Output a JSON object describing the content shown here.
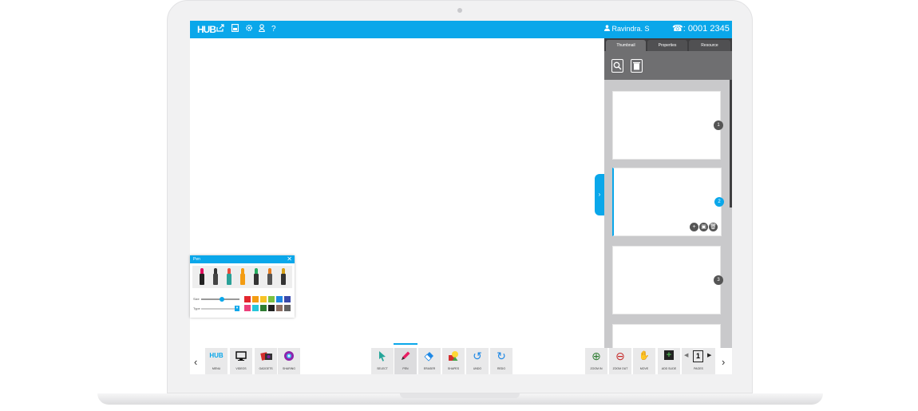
{
  "header": {
    "logo": "HUB",
    "icons": [
      "share-icon",
      "save-icon",
      "settings-icon",
      "user-icon",
      "help-icon"
    ],
    "help_glyph": "?",
    "user_name": "Ravindra. S",
    "phone_glyph": "☎",
    "phone_text": ": 0001 2345"
  },
  "right_panel": {
    "tabs": [
      {
        "label": "Thumbnail",
        "active": true
      },
      {
        "label": "Properties",
        "active": false
      },
      {
        "label": "Resource",
        "active": false
      }
    ],
    "tools": [
      "search-icon",
      "trash-icon"
    ],
    "thumbnails": [
      {
        "number": "1",
        "active": false
      },
      {
        "number": "2",
        "active": true
      },
      {
        "number": "3",
        "active": false
      },
      {
        "number": "",
        "active": false
      }
    ],
    "thumb_actions": [
      "+",
      "▣",
      "🗑"
    ]
  },
  "collapse_glyph": "›",
  "pen_dialog": {
    "title": "Pen",
    "close": "✕",
    "size_label": "Size",
    "type_label": "Type",
    "size_value": 0.55,
    "pens": [
      {
        "tip": "#e0115f",
        "body": "#222222"
      },
      {
        "tip": "#333333",
        "body": "#444444"
      },
      {
        "tip": "#e74c3c",
        "body": "#2aa198"
      },
      {
        "tip": "#f39c12",
        "body": "#f39c12"
      },
      {
        "tip": "#27ae60",
        "body": "#333333"
      },
      {
        "tip": "#e67e22",
        "body": "#555555"
      },
      {
        "tip": "#d4a017",
        "body": "#333333"
      }
    ],
    "colors": [
      "#e3262e",
      "#f39c12",
      "#f7c325",
      "#7ac142",
      "#1e88e5",
      "#3949ab",
      "#ec407a",
      "#26c6da",
      "#2e7d32",
      "#212121",
      "#8d6e63",
      "#616161"
    ]
  },
  "toolbar": {
    "left": [
      {
        "label": "MENU",
        "icon": "HUB"
      },
      {
        "label": "VIDEOS",
        "icon": "🖥"
      },
      {
        "label": "GADGETS",
        "icon": "🎬"
      },
      {
        "label": "SHARING",
        "icon": "◉"
      }
    ],
    "center": [
      {
        "label": "SELECT",
        "icon": "↖"
      },
      {
        "label": "PEN",
        "icon": "✎"
      },
      {
        "label": "ERASER",
        "icon": "◆"
      },
      {
        "label": "SHAPES",
        "icon": "■"
      },
      {
        "label": "UNDO",
        "icon": "↺"
      },
      {
        "label": "REDO",
        "icon": "↻"
      }
    ],
    "right": [
      {
        "label": "ZOOM IN",
        "icon": "⊕"
      },
      {
        "label": "ZOOM OUT",
        "icon": "⊖"
      },
      {
        "label": "MOVE",
        "icon": "✋"
      },
      {
        "label": "ADD SLIDE",
        "icon": "+"
      },
      {
        "label": "PAGES",
        "icon": "1"
      }
    ],
    "prev_glyph": "‹",
    "next_glyph": "›",
    "page_prev": "◀",
    "page_next": "▶"
  },
  "colors": {
    "accent": "#0aa7ea"
  }
}
